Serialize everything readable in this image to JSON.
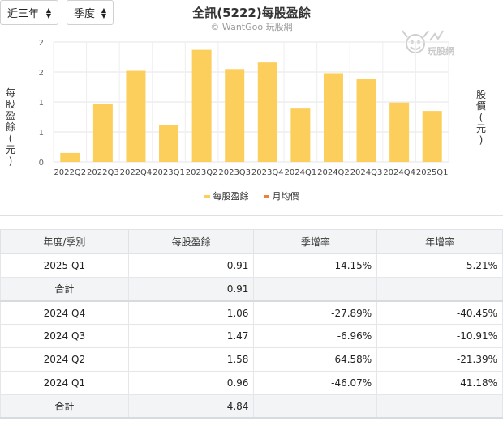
{
  "controls": {
    "range_label": "近三年",
    "period_label": "季度"
  },
  "logo_text": "玩股網",
  "chart_data": {
    "type": "bar",
    "title": "全訊(5222)每股盈餘",
    "subtitle": "© WantGoo 玩股網",
    "ylabel_left": [
      "每",
      "股",
      "盈",
      "餘",
      "(",
      "元",
      ")"
    ],
    "ylabel_right": [
      "股",
      "價",
      "(",
      "元",
      ")"
    ],
    "categories": [
      "2022Q2",
      "2022Q3",
      "2022Q4",
      "2023Q1",
      "2023Q2",
      "2023Q3",
      "2023Q4",
      "2024Q1",
      "2024Q2",
      "2024Q3",
      "2024Q4",
      "2025Q1"
    ],
    "series": [
      {
        "name": "每股盈餘",
        "values": [
          0.15,
          0.96,
          1.52,
          0.62,
          1.87,
          1.55,
          1.66,
          0.89,
          1.48,
          1.38,
          0.99,
          0.85
        ]
      },
      {
        "name": "月均價",
        "values": []
      }
    ],
    "y_ticks": [
      0,
      0.5,
      1,
      1.5,
      2
    ],
    "y_tick_labels": [
      "0",
      "1",
      "1",
      "2",
      "2"
    ],
    "ylim": [
      0,
      2
    ],
    "grid": true,
    "legend_position": "bottom",
    "colors": {
      "bar": "#fccf5c",
      "line": "#f07f3c"
    }
  },
  "table": {
    "headers": [
      "年度/季別",
      "每股盈餘",
      "季增率",
      "年增率"
    ],
    "rows": [
      {
        "period": "2025 Q1",
        "eps": "0.91",
        "qoq": "-14.15%",
        "yoy": "-5.21%",
        "total": false
      },
      {
        "period": "合計",
        "eps": "0.91",
        "qoq": "",
        "yoy": "",
        "total": true
      },
      {
        "period": "2024 Q4",
        "eps": "1.06",
        "qoq": "-27.89%",
        "yoy": "-40.45%",
        "total": false
      },
      {
        "period": "2024 Q3",
        "eps": "1.47",
        "qoq": "-6.96%",
        "yoy": "-10.91%",
        "total": false
      },
      {
        "period": "2024 Q2",
        "eps": "1.58",
        "qoq": "64.58%",
        "yoy": "-21.39%",
        "total": false
      },
      {
        "period": "2024 Q1",
        "eps": "0.96",
        "qoq": "-46.07%",
        "yoy": "41.18%",
        "total": false
      },
      {
        "period": "合計",
        "eps": "4.84",
        "qoq": "",
        "yoy": "",
        "total": true
      }
    ]
  }
}
